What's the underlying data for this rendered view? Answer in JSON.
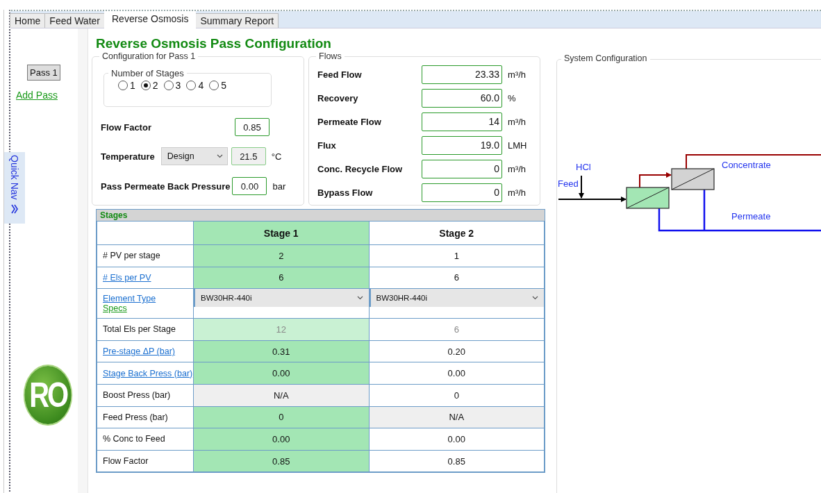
{
  "tabs": [
    {
      "label": "Home",
      "selected": false
    },
    {
      "label": "Feed Water",
      "selected": false
    },
    {
      "label": "Reverse Osmosis",
      "selected": true
    },
    {
      "label": "Summary Report",
      "selected": false
    }
  ],
  "sidebar": {
    "pass_button": "Pass 1",
    "add_pass": "Add Pass",
    "quick_nav": "Quick Nav",
    "logo": "RO"
  },
  "title": "Reverse Osmosis Pass Configuration",
  "configuration": {
    "title": "Configuration for Pass 1",
    "stage_count": {
      "title": "Number of Stages",
      "options": [
        {
          "label": "1",
          "selected": false
        },
        {
          "label": "2",
          "selected": true
        },
        {
          "label": "3",
          "selected": false
        },
        {
          "label": "4",
          "selected": false
        },
        {
          "label": "5",
          "selected": false
        }
      ]
    },
    "flow_factor": {
      "label": "Flow Factor",
      "value": "0.85"
    },
    "temperature": {
      "label": "Temperature",
      "mode": "Design",
      "value": "21.5",
      "unit": "°C",
      "readonly": true
    },
    "back_pressure": {
      "label": "Pass Permeate Back Pressure",
      "value": "0.00",
      "unit": "bar"
    }
  },
  "flows": {
    "title": "Flows",
    "rows": [
      {
        "label": "Feed Flow",
        "value": "23.33",
        "unit": "m³/h"
      },
      {
        "label": "Recovery",
        "value": "60.0",
        "unit": "%"
      },
      {
        "label": "Permeate Flow",
        "value": "14",
        "unit": "m³/h"
      },
      {
        "label": "Flux",
        "value": "19.0",
        "unit": "LMH"
      },
      {
        "label": "Conc. Recycle Flow",
        "value": "0",
        "unit": "m³/h"
      },
      {
        "label": "Bypass Flow",
        "value": "0",
        "unit": "m³/h"
      }
    ]
  },
  "stages": {
    "title": "Stages",
    "columns": [
      {
        "label": "Stage 1",
        "selected": true
      },
      {
        "label": "Stage 2",
        "selected": false
      }
    ],
    "rows": [
      {
        "label": "# PV per stage",
        "link": false,
        "cells": [
          {
            "kind": "input",
            "value": "2"
          },
          {
            "kind": "input",
            "value": "1"
          }
        ]
      },
      {
        "label": "# Els per PV",
        "link": true,
        "cells": [
          {
            "kind": "input",
            "value": "6"
          },
          {
            "kind": "input",
            "value": "6"
          }
        ]
      },
      {
        "label": "Element Type",
        "link": true,
        "sublabel": "Specs",
        "cells": [
          {
            "kind": "select",
            "value": "BW30HR-440i"
          },
          {
            "kind": "select",
            "value": "BW30HR-440i"
          }
        ]
      },
      {
        "label": "Total Els per Stage",
        "link": false,
        "cells": [
          {
            "kind": "computed",
            "value": "12"
          },
          {
            "kind": "computed",
            "value": "6"
          }
        ]
      },
      {
        "label": "Pre-stage ΔP (bar)",
        "link": true,
        "cells": [
          {
            "kind": "input",
            "value": "0.31"
          },
          {
            "kind": "input",
            "value": "0.20"
          }
        ]
      },
      {
        "label": "Stage Back Press (bar)",
        "link": true,
        "cells": [
          {
            "kind": "input",
            "value": "0.00"
          },
          {
            "kind": "input",
            "value": "0.00"
          }
        ]
      },
      {
        "label": "Boost Press (bar)",
        "link": false,
        "cells": [
          {
            "kind": "na",
            "value": "N/A"
          },
          {
            "kind": "input",
            "value": "0"
          }
        ]
      },
      {
        "label": "Feed Press (bar)",
        "link": false,
        "cells": [
          {
            "kind": "input",
            "value": "0"
          },
          {
            "kind": "na",
            "value": "N/A"
          }
        ]
      },
      {
        "label": "% Conc to Feed",
        "link": false,
        "cells": [
          {
            "kind": "input",
            "value": "0.00"
          },
          {
            "kind": "input",
            "value": "0.00"
          }
        ]
      },
      {
        "label": "Flow Factor",
        "link": false,
        "cells": [
          {
            "kind": "input",
            "value": "0.85"
          },
          {
            "kind": "input",
            "value": "0.85"
          }
        ]
      }
    ]
  },
  "system_configuration": {
    "title": "System Configuration",
    "chemical": "HCl",
    "feed": "Feed",
    "concentrate": "Concentrate",
    "permeate": "Permeate"
  }
}
